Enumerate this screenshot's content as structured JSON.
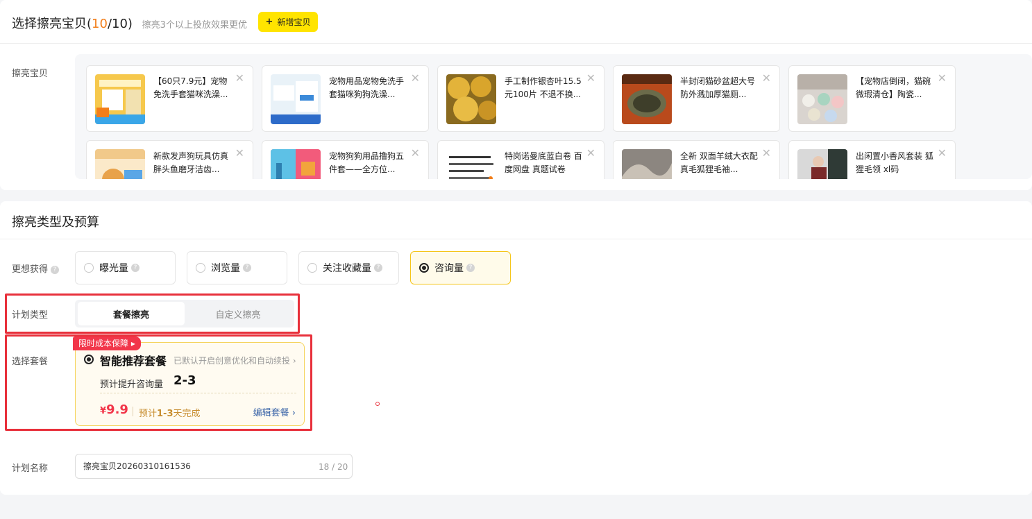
{
  "section1": {
    "title_prefix": "选择擦亮宝贝(",
    "count_current": "10",
    "count_suffix": "/10)",
    "subtitle": "擦亮3个以上投放效果更优",
    "add_button": "新增宝贝",
    "row_label": "擦亮宝贝"
  },
  "products": [
    {
      "title": "【60只7.9元】宠物免洗手套猫咪洗澡..."
    },
    {
      "title": "宠物用品宠物免洗手套猫咪狗狗洗澡..."
    },
    {
      "title": "手工制作银杏叶15.5元100片 不退不换..."
    },
    {
      "title": "半封闭猫砂盆超大号防外溅加厚猫厕..."
    },
    {
      "title": "【宠物店倒闭，猫碗微瑕清仓】陶瓷..."
    },
    {
      "title": "新款发声狗玩具仿真胖头鱼磨牙洁齿..."
    },
    {
      "title": "宠物狗狗用品撸狗五件套——全方位..."
    },
    {
      "title": "特岗诺曼底蓝白卷 百度网盘 真题试卷"
    },
    {
      "title": "全新 双面羊绒大衣配真毛狐狸毛袖..."
    },
    {
      "title": "出闲置小香风套装 狐狸毛领 xl码"
    }
  ],
  "section2": {
    "title": "擦亮类型及预算",
    "goal_label": "更想获得",
    "goals": [
      {
        "label": "曝光量",
        "selected": false
      },
      {
        "label": "浏览量",
        "selected": false
      },
      {
        "label": "关注收藏量",
        "selected": false
      },
      {
        "label": "咨询量",
        "selected": true
      }
    ],
    "plan_type_label": "计划类型",
    "plan_types": [
      "套餐擦亮",
      "自定义擦亮"
    ],
    "package_label": "选择套餐",
    "package": {
      "tag": "限时成本保障",
      "name": "智能推荐套餐",
      "note": "已默认开启创意优化和自动续投",
      "estimate_label": "预计提升咨询量",
      "estimate_value": "2-3",
      "price_currency": "¥",
      "price": "9.9",
      "eta_prefix": "预计",
      "eta_days": "1-3",
      "eta_suffix": "天完成",
      "edit": "编辑套餐"
    },
    "plan_name_label": "计划名称",
    "plan_name_value": "擦亮宝贝20260310161536",
    "plan_name_count": "18 / 20"
  },
  "colors": {
    "accent_yellow": "#ffe400",
    "highlight_orange": "#f27e1a",
    "price_red": "#f2364a",
    "annotation_red": "#e8303b"
  }
}
